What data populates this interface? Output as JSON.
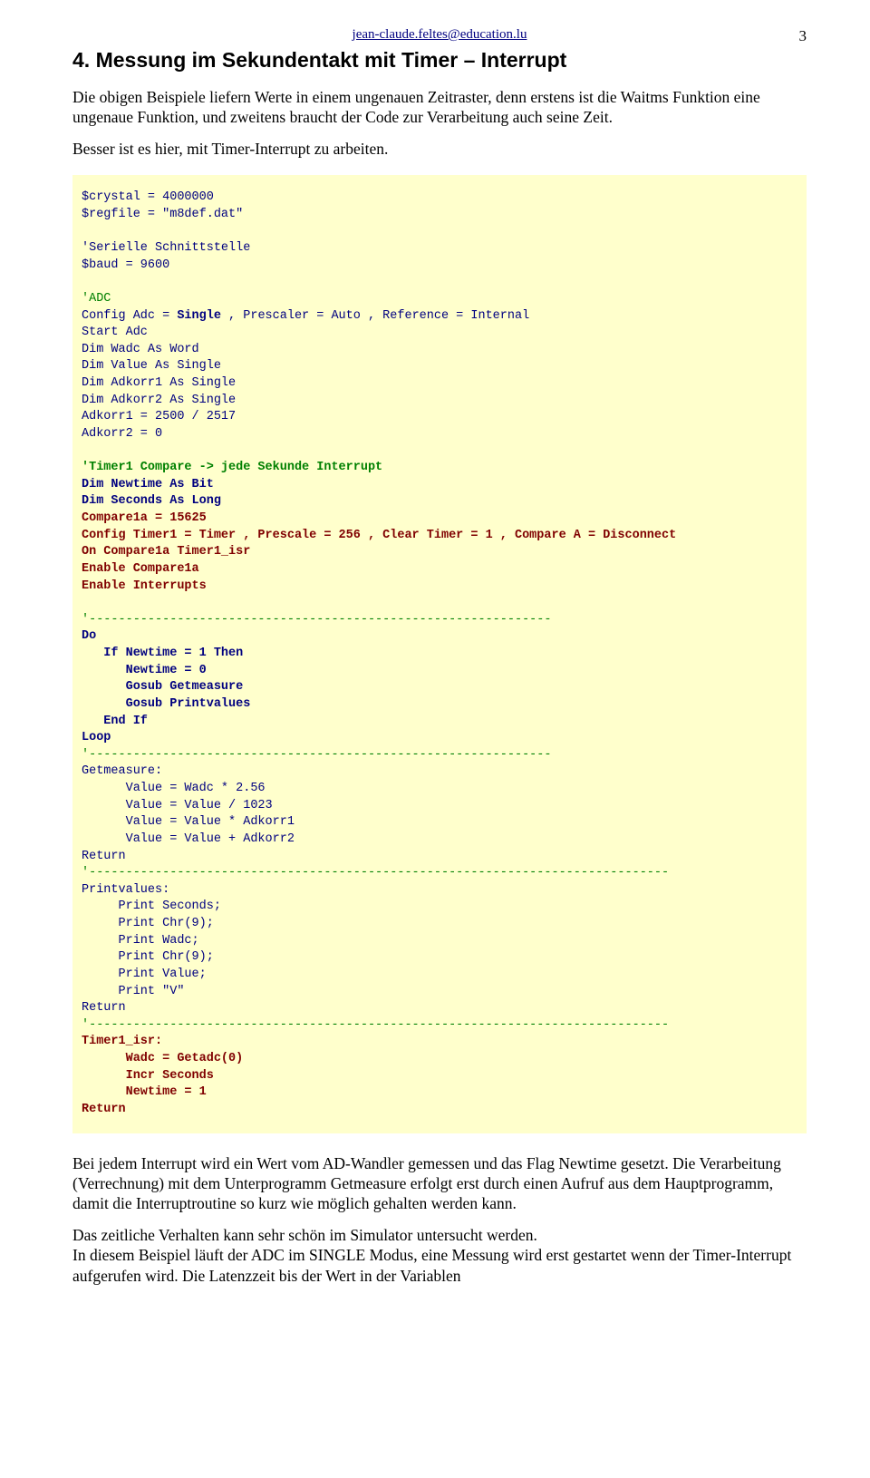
{
  "header_email": "jean-claude.feltes@education.lu",
  "page_number": "3",
  "heading": "4. Messung im Sekundentakt mit Timer – Interrupt",
  "intro_1": "Die obigen Beispiele liefern Werte in einem ungenauen Zeitraster, denn erstens  ist die Waitms Funktion eine ungenaue Funktion, und zweitens braucht der Code zur Verarbeitung auch seine Zeit.",
  "intro_2": "Besser ist es hier, mit Timer-Interrupt zu arbeiten.",
  "code": {
    "l1": "$crystal = 4000000",
    "l2": "$regfile = \"m8def.dat\"",
    "l3": "'Serielle Schnittstelle",
    "l4": "$baud = 9600",
    "l5": "'ADC",
    "l6a": "Config Adc = ",
    "l6b": "Single",
    "l6c": " , Prescaler = Auto , Reference = Internal",
    "l7": "Start Adc",
    "l8": "Dim Wadc As Word",
    "l9": "Dim Value As Single",
    "l10": "Dim Adkorr1 As Single",
    "l11": "Dim Adkorr2 As Single",
    "l12": "Adkorr1 = 2500 / 2517",
    "l13": "Adkorr2 = 0",
    "l14": "'Timer1 Compare -> jede Sekunde Interrupt",
    "l15": "Dim Newtime As Bit",
    "l16": "Dim Seconds As Long",
    "l17": "Compare1a = 15625",
    "l18": "Config Timer1 = Timer , Prescale = 256 , Clear Timer = 1 , Compare A = Disconnect",
    "l19": "On Compare1a Timer1_isr",
    "l20": "Enable Compare1a",
    "l21": "Enable Interrupts",
    "sep1": "'---------------------------------------------------------------",
    "l22": "Do",
    "l23": "   If Newtime = 1 Then",
    "l24": "      Newtime = 0",
    "l25": "      Gosub Getmeasure",
    "l26": "      Gosub Printvalues",
    "l27": "   End If",
    "l28": "Loop",
    "sep2": "'---------------------------------------------------------------",
    "l29": "Getmeasure:",
    "l30": "      Value = Wadc * 2.56",
    "l31": "      Value = Value / 1023",
    "l32": "      Value = Value * Adkorr1",
    "l33": "      Value = Value + Adkorr2",
    "l34": "Return",
    "sep3": "'-------------------------------------------------------------------------------",
    "l35": "Printvalues:",
    "l36": "     Print Seconds;",
    "l37": "     Print Chr(9);",
    "l38": "     Print Wadc;",
    "l39": "     Print Chr(9);",
    "l40": "     Print Value;",
    "l41": "     Print \"V\"",
    "l42": "Return",
    "sep4": "'-------------------------------------------------------------------------------",
    "l43": "Timer1_isr:",
    "l44": "      Wadc = Getadc(0)",
    "l45": "      Incr Seconds",
    "l46": "      Newtime = 1",
    "l47": "Return"
  },
  "footer_1": "Bei jedem Interrupt wird ein Wert vom AD-Wandler gemessen und das Flag Newtime gesetzt. Die Verarbeitung (Verrechnung) mit dem Unterprogramm Getmeasure erfolgt erst durch einen Aufruf aus dem Hauptprogramm, damit die Interruptroutine so kurz wie möglich gehalten werden kann.",
  "footer_2": "Das zeitliche Verhalten kann sehr schön im Simulator untersucht werden.",
  "footer_3": "In diesem Beispiel läuft der ADC im SINGLE Modus, eine Messung wird erst gestartet wenn der Timer-Interrupt aufgerufen wird. Die Latenzzeit bis der Wert in der Variablen"
}
